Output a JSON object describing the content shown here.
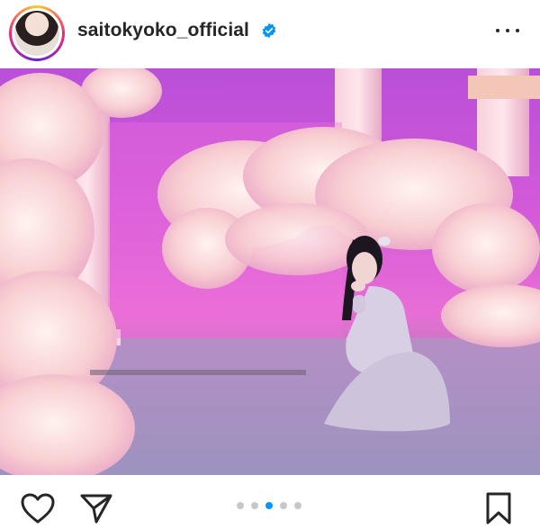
{
  "post": {
    "username": "saitokyoko_official",
    "verified": true,
    "carousel": {
      "total": 5,
      "active_index": 2
    }
  },
  "icons": {
    "verified": "verified-badge-icon",
    "more": "more-options-icon",
    "like": "heart-icon",
    "share": "paper-plane-icon",
    "save": "bookmark-icon"
  },
  "colors": {
    "verified_blue": "#0095f6",
    "active_dot": "#0095f6",
    "inactive_dot": "#c7c7c7",
    "text": "#262626"
  }
}
